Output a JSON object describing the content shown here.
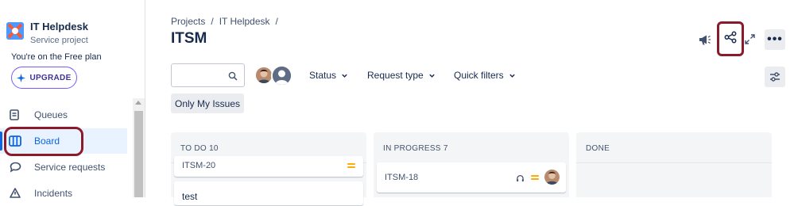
{
  "project": {
    "name": "IT Helpdesk",
    "type": "Service project"
  },
  "plan": {
    "text": "You're on the Free plan",
    "upgrade_label": "UPGRADE"
  },
  "nav": [
    {
      "label": "Queues",
      "icon": "queues-icon"
    },
    {
      "label": "Board",
      "icon": "board-icon",
      "active": true
    },
    {
      "label": "Service requests",
      "icon": "service-requests-icon"
    },
    {
      "label": "Incidents",
      "icon": "incidents-icon"
    }
  ],
  "breadcrumb": [
    "Projects",
    "/",
    "IT Helpdesk",
    "/"
  ],
  "page_title": "ITSM",
  "filters": {
    "search_placeholder": "",
    "status_label": "Status",
    "request_type_label": "Request type",
    "quick_filters_label": "Quick filters",
    "only_my_issues_label": "Only My Issues"
  },
  "columns": [
    {
      "header": "TO DO 10",
      "cards": [
        {
          "key": "ITSM-20"
        },
        {
          "key": "test"
        }
      ]
    },
    {
      "header": "IN PROGRESS 7",
      "cards": [
        {
          "key": "ITSM-18"
        }
      ]
    },
    {
      "header": "DONE",
      "cards": []
    }
  ],
  "colors": {
    "accent": "#0c66e4",
    "highlight": "#8b1a2a",
    "priority_medium": "#ffab00",
    "upgrade_border": "#7a5af8"
  }
}
